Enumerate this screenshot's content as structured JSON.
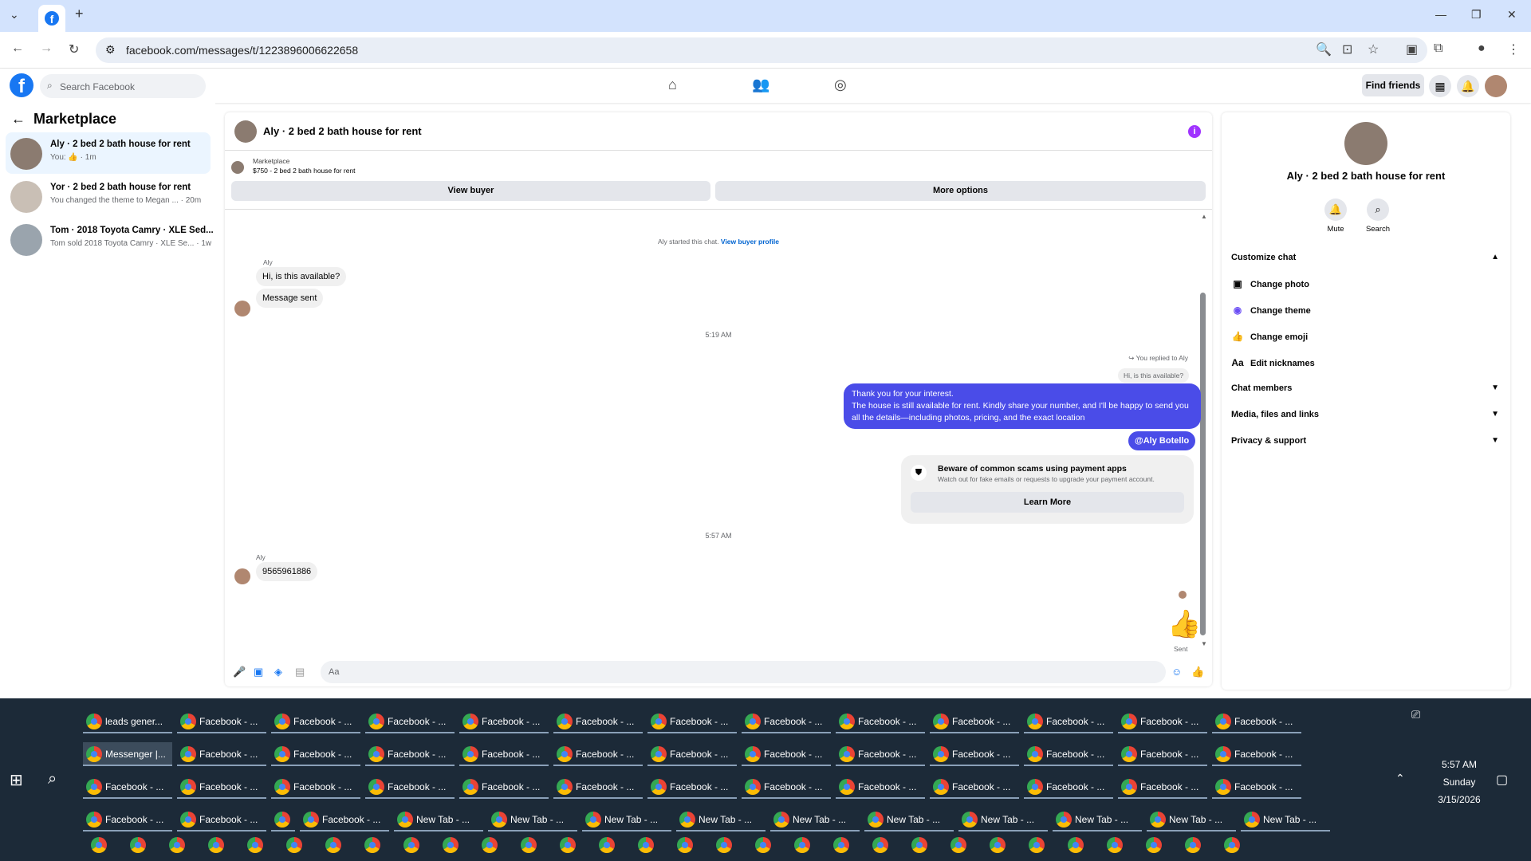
{
  "browser": {
    "url": "facebook.com/messages/t/1223896006622658",
    "new_tab": "+"
  },
  "fb": {
    "search_placeholder": "Search Facebook",
    "find_friends": "Find friends"
  },
  "left": {
    "title": "Marketplace",
    "conversations": [
      {
        "title": "Aly · 2 bed 2 bath house for rent",
        "subtitle": "You: 👍 · 1m"
      },
      {
        "title": "Yor · 2 bed 2 bath house for rent",
        "subtitle": "You changed the theme to Megan ... · 20m"
      },
      {
        "title": "Tom · 2018 Toyota Camry · XLE Sed...",
        "subtitle": "Tom sold 2018 Toyota Camry · XLE Se... · 1w"
      }
    ]
  },
  "chat": {
    "title": "Aly · 2 bed 2 bath house for rent",
    "marketplace_label": "Marketplace",
    "listing": "$750 - 2 bed 2 bath house for rent",
    "view_buyer": "View buyer",
    "more_options": "More options",
    "started": "Aly started this chat.",
    "view_profile": "View buyer profile",
    "sender": "Aly",
    "msg1": "Hi, is this available?",
    "msg2": "Message sent",
    "time1": "5:19 AM",
    "replied": "You replied to Aly",
    "quote": "Hi, is this available?",
    "reply_lines": [
      "Thank you for your interest.",
      "The house is still available for rent. Kindly share your number, and I'll be happy to send you all the details—including photos, pricing, and the exact location"
    ],
    "mention": "@Aly Botello",
    "scam_title": "Beware of common scams using payment apps",
    "scam_body": "Watch out for fake emails or requests to upgrade your payment account.",
    "learn_more": "Learn More",
    "time2": "5:57 AM",
    "sender2": "Aly",
    "msg3": "9565961886",
    "sent": "Sent",
    "composer_placeholder": "Aa"
  },
  "right": {
    "name": "Aly · 2 bed 2 bath house for rent",
    "mute": "Mute",
    "search": "Search",
    "customize": "Customize chat",
    "options": [
      "Change photo",
      "Change theme",
      "Change emoji",
      "Edit nicknames"
    ],
    "sections": [
      "Chat members",
      "Media, files and links",
      "Privacy & support"
    ]
  },
  "taskbar": {
    "row1": [
      "leads gener...",
      "Facebook - ...",
      "Facebook - ...",
      "Facebook - ...",
      "Facebook - ...",
      "Facebook - ...",
      "Facebook - ...",
      "Facebook - ...",
      "Facebook - ...",
      "Facebook - ...",
      "Facebook - ...",
      "Facebook - ...",
      "Facebook - ..."
    ],
    "row2": [
      "Messenger |...",
      "Facebook - ...",
      "Facebook - ...",
      "Facebook - ...",
      "Facebook - ...",
      "Facebook - ...",
      "Facebook - ...",
      "Facebook - ...",
      "Facebook - ...",
      "Facebook - ...",
      "Facebook - ...",
      "Facebook - ...",
      "Facebook - ..."
    ],
    "row3": [
      "Facebook - ...",
      "Facebook - ...",
      "Facebook - ...",
      "Facebook - ...",
      "Facebook - ...",
      "Facebook - ...",
      "Facebook - ...",
      "Facebook - ...",
      "Facebook - ...",
      "Facebook - ...",
      "Facebook - ...",
      "Facebook - ...",
      "Facebook - ..."
    ],
    "row4": [
      "Facebook - ...",
      "Facebook - ...",
      "",
      "Facebook - ...",
      "New Tab - ...",
      "New Tab - ...",
      "New Tab - ...",
      "New Tab - ...",
      "New Tab - ...",
      "New Tab - ...",
      "New Tab - ...",
      "New Tab - ...",
      "New Tab - ...",
      "New Tab - ..."
    ],
    "time": "5:57 AM",
    "day": "Sunday",
    "date": "3/15/2026"
  }
}
